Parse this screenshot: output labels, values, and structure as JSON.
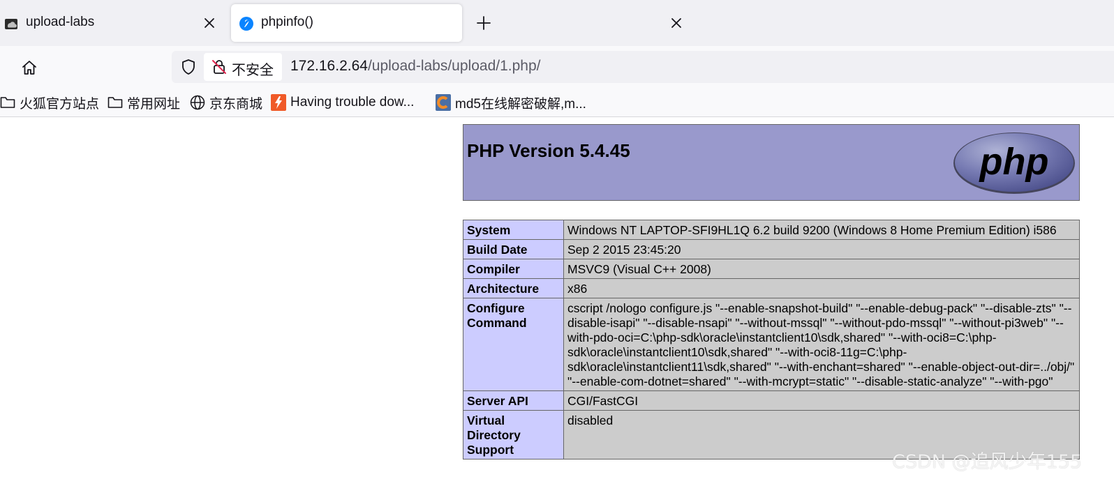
{
  "tabs": [
    {
      "title": "upload-labs",
      "favicon": "upload-labs-favicon-icon",
      "active": false
    },
    {
      "title": "phpinfo()",
      "favicon": "firefox-favicon-icon",
      "active": true
    }
  ],
  "navbar": {
    "security_label": "不安全",
    "url_host": "172.16.2.64",
    "url_path": "/upload-labs/upload/1.php/"
  },
  "bookmarks": [
    {
      "label": "火狐官方站点",
      "icon": "folder-icon"
    },
    {
      "label": "常用网址",
      "icon": "folder-icon"
    },
    {
      "label": "京东商城",
      "icon": "globe-icon"
    },
    {
      "label": "Having trouble dow...",
      "icon": "site-favicon-icon"
    },
    {
      "label": "md5在线解密破解,m...",
      "icon": "site-favicon-icon"
    }
  ],
  "phpinfo": {
    "version_title": "PHP Version 5.4.45",
    "logo_text": "php",
    "rows": [
      {
        "key": "System",
        "value": "Windows NT LAPTOP-SFI9HL1Q 6.2 build 9200 (Windows 8 Home Premium Edition) i586"
      },
      {
        "key": "Build Date",
        "value": "Sep 2 2015 23:45:20"
      },
      {
        "key": "Compiler",
        "value": "MSVC9 (Visual C++ 2008)"
      },
      {
        "key": "Architecture",
        "value": "x86"
      },
      {
        "key": "Configure Command",
        "value": "cscript /nologo configure.js \"--enable-snapshot-build\" \"--enable-debug-pack\" \"--disable-zts\" \"--disable-isapi\" \"--disable-nsapi\" \"--without-mssql\" \"--without-pdo-mssql\" \"--without-pi3web\" \"--with-pdo-oci=C:\\php-sdk\\oracle\\instantclient10\\sdk,shared\" \"--with-oci8=C:\\php-sdk\\oracle\\instantclient10\\sdk,shared\" \"--with-oci8-11g=C:\\php-sdk\\oracle\\instantclient11\\sdk,shared\" \"--with-enchant=shared\" \"--enable-object-out-dir=../obj/\" \"--enable-com-dotnet=shared\" \"--with-mcrypt=static\" \"--disable-static-analyze\" \"--with-pgo\""
      },
      {
        "key": "Server API",
        "value": "CGI/FastCGI"
      },
      {
        "key": "Virtual Directory Support",
        "value": "disabled"
      }
    ]
  },
  "watermark": "CSDN @追风少年155",
  "colors": {
    "header_bg": "#9999cc",
    "key_cell_bg": "#ccccff",
    "value_cell_bg": "#cccccc",
    "tabstrip_bg": "#f0f0f4"
  }
}
